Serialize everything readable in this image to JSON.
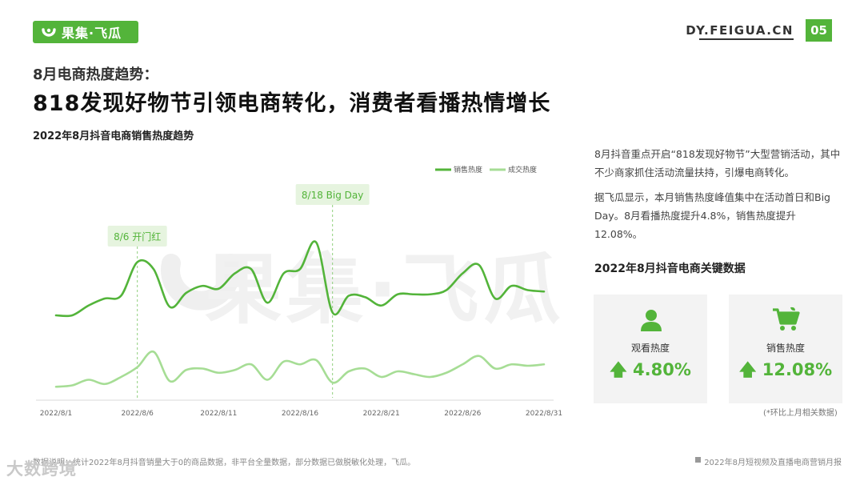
{
  "header": {
    "brand": "果集·飞瓜",
    "site": "DY.FEIGUA.CN",
    "page_number": "05",
    "accent_color": "#53b43a"
  },
  "headline": {
    "sub": "8月电商热度趋势：",
    "main": "818发现好物节引领电商转化，消费者看播热情增长"
  },
  "watermark": "果集·飞瓜",
  "chart_data": {
    "type": "line",
    "title": "2022年8月抖音电商销售热度趋势",
    "x": [
      "2022/8/1",
      "2022/8/2",
      "2022/8/3",
      "2022/8/4",
      "2022/8/5",
      "2022/8/6",
      "2022/8/7",
      "2022/8/8",
      "2022/8/9",
      "2022/8/10",
      "2022/8/11",
      "2022/8/12",
      "2022/8/13",
      "2022/8/14",
      "2022/8/15",
      "2022/8/16",
      "2022/8/17",
      "2022/8/18",
      "2022/8/19",
      "2022/8/20",
      "2022/8/21",
      "2022/8/22",
      "2022/8/23",
      "2022/8/24",
      "2022/8/25",
      "2022/8/26",
      "2022/8/27",
      "2022/8/28",
      "2022/8/29",
      "2022/8/30",
      "2022/8/31"
    ],
    "xticks": [
      "2022/8/1",
      "2022/8/6",
      "2022/8/11",
      "2022/8/16",
      "2022/8/21",
      "2022/8/26",
      "2022/8/31"
    ],
    "series": [
      {
        "name": "销售热度",
        "color": "#53b43a",
        "values": [
          0.56,
          0.56,
          0.63,
          0.68,
          0.7,
          0.94,
          0.89,
          0.62,
          0.72,
          0.77,
          0.75,
          0.86,
          0.89,
          0.65,
          0.86,
          0.89,
          1.08,
          0.58,
          0.7,
          0.69,
          0.63,
          0.71,
          0.71,
          0.71,
          0.74,
          0.86,
          0.92,
          0.68,
          0.77,
          0.74,
          0.73
        ]
      },
      {
        "name": "成交热度",
        "color": "#a6dd95",
        "values": [
          0.05,
          0.06,
          0.1,
          0.07,
          0.12,
          0.19,
          0.3,
          0.09,
          0.17,
          0.18,
          0.15,
          0.17,
          0.21,
          0.1,
          0.23,
          0.21,
          0.24,
          0.08,
          0.16,
          0.18,
          0.12,
          0.16,
          0.14,
          0.12,
          0.15,
          0.21,
          0.27,
          0.18,
          0.21,
          0.2,
          0.21
        ]
      }
    ],
    "ylim": [
      0,
      1.2
    ],
    "grid": false,
    "legend": "top-right",
    "annotations": [
      {
        "x": "2022/8/6",
        "label": "8/6 开门红"
      },
      {
        "x": "2022/8/18",
        "label": "8/18 Big Day"
      }
    ]
  },
  "description": {
    "p1": "8月抖音重点开启“818发现好物节”大型营销活动，其中不少商家抓住活动流量扶持，引爆电商转化。",
    "p2": "据飞瓜显示，本月销售热度峰值集中在活动首日和Big Day。8月看播热度提升4.8%，销售热度提升12.08%。"
  },
  "key_data": {
    "title": "2022年8月抖音电商关键数据",
    "cards": [
      {
        "icon": "user-icon",
        "label": "观看热度",
        "value": "4.80%",
        "trend": "up"
      },
      {
        "icon": "cart-icon",
        "label": "销售热度",
        "value": "12.08%",
        "trend": "up"
      }
    ],
    "note": "(*环比上月相关数据)"
  },
  "footer": {
    "source": "数据说明：统计2022年8月抖音销量大于0的商品数据，非平台全量数据，部分数据已做脱敏化处理，飞瓜。",
    "report": "2022年8月短视频及直播电商营销月报",
    "corner_watermark": "大数跨境"
  }
}
